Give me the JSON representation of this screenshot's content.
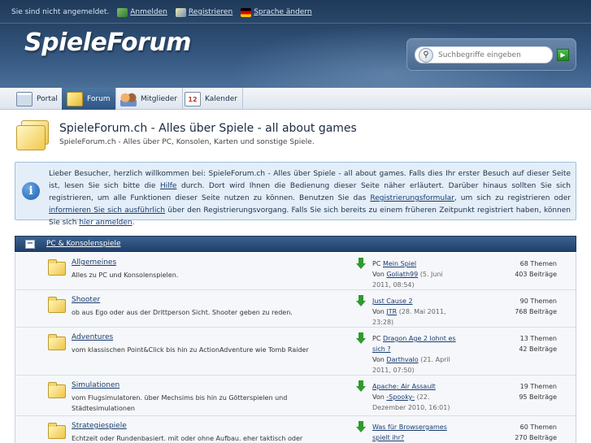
{
  "userbar": {
    "status": "Sie sind nicht angemeldet.",
    "login": "Anmelden",
    "register": "Registrieren",
    "language": "Sprache ändern"
  },
  "logo": "SpieleForum",
  "search": {
    "placeholder": "Suchbegriffe eingeben"
  },
  "tabs": [
    {
      "label": "Portal",
      "icon": "portal-icon"
    },
    {
      "label": "Forum",
      "icon": "forum-folder-icon",
      "active": true
    },
    {
      "label": "Mitglieder",
      "icon": "members-icon"
    },
    {
      "label": "Kalender",
      "icon": "calendar-icon",
      "badge": "12"
    }
  ],
  "page": {
    "title": "SpieleForum.ch - Alles über Spiele - all about games",
    "subtitle": "SpieleForum.ch - Alles über PC, Konsolen, Karten und sonstige Spiele."
  },
  "info": {
    "t1": "Lieber Besucher, herzlich willkommen bei: SpieleForum.ch - Alles über Spiele - all about games. Falls dies Ihr erster Besuch auf dieser Seite ist, lesen Sie sich bitte die ",
    "help_link": "Hilfe",
    "t2": " durch. Dort wird Ihnen die Bedienung dieser Seite näher erläutert. Darüber hinaus sollten Sie sich registrieren, um alle Funktionen dieser Seite nutzen zu können. Benutzen Sie das ",
    "form_link": "Registrierungsformular",
    "t3": ", um sich zu registrieren oder ",
    "more_link": "informieren Sie sich ausführlich",
    "t4": " über den Registrierungsvorgang. Falls Sie sich bereits zu einem früheren Zeitpunkt registriert haben, können Sie sich ",
    "login_link": "hier anmelden",
    "t5": "."
  },
  "category": {
    "toggle": "−",
    "name": "PC & Konsolenspiele"
  },
  "forums": [
    {
      "name": "Allgemeines",
      "desc": "Alles zu PC und Konsolenspielen.",
      "last_prefix": "PC ",
      "last_title": "Mein Spiel",
      "by": "Von ",
      "last_user": "Goliath99",
      "last_date": " (5. Juni 2011, 08:54)",
      "threads": "68 Themen",
      "posts": "403 Beiträge"
    },
    {
      "name": "Shooter",
      "desc": "ob aus Ego oder aus der Drittperson Sicht. Shooter geben zu reden.",
      "last_prefix": "",
      "last_title": "Just Cause 2",
      "by": "Von ",
      "last_user": "JTR",
      "last_date": " (28. Mai 2011, 23:28)",
      "threads": "90 Themen",
      "posts": "768 Beiträge"
    },
    {
      "name": "Adventures",
      "desc": "vom klassischen Point&Click bis hin zu ActionAdventure wie Tomb Raider",
      "last_prefix": "PC ",
      "last_title": "Dragon Age 2 lohnt es sich ?",
      "by": "Von ",
      "last_user": "Darthvalo",
      "last_date": " (21. April 2011, 07:50)",
      "threads": "13 Themen",
      "posts": "42 Beiträge"
    },
    {
      "name": "Simulationen",
      "desc": "vom Flugsimulatoren. über Mechsims bis hin zu Götterspielen und Städtesimulationen",
      "last_prefix": "",
      "last_title": "Apache: Air Assault",
      "by": "Von ",
      "last_user": "-Spooky-",
      "last_date": " (22. Dezember 2010, 16:01)",
      "threads": "19 Themen",
      "posts": "95 Beiträge"
    },
    {
      "name": "Strategiespiele",
      "desc": "Echtzeit oder Rundenbasiert. mit oder ohne Aufbau. eher taktisch oder eben",
      "last_prefix": "",
      "last_title": "Was für Browsergames spielt ihr?",
      "by": "",
      "last_user": "",
      "last_date": "",
      "threads": "60 Themen",
      "posts": "270 Beiträge"
    }
  ],
  "colors": {
    "header": "#2c4b70",
    "accent": "#1a3c6e",
    "info_bg": "#e3eef9",
    "category_bar": "#2d5684"
  }
}
